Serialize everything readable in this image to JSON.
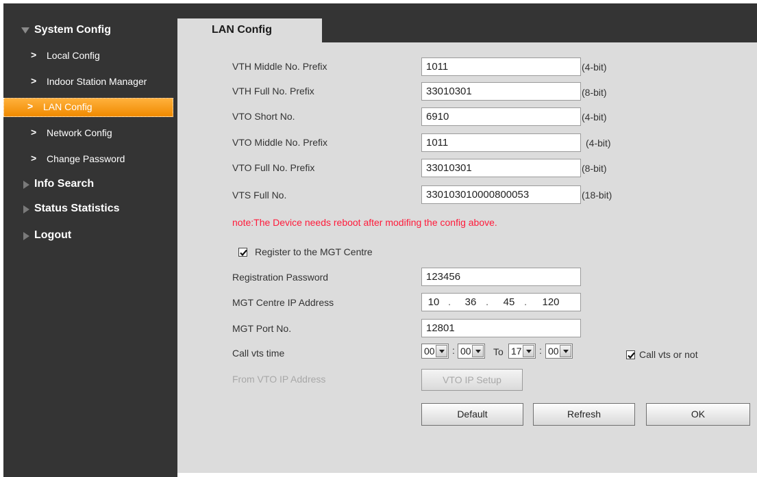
{
  "sidebar": {
    "sections": [
      {
        "label": "System Config",
        "expanded": true
      },
      {
        "label": "Info Search",
        "expanded": false
      },
      {
        "label": "Status Statistics",
        "expanded": false
      },
      {
        "label": "Logout",
        "expanded": false
      }
    ],
    "items": [
      {
        "label": "Local Config"
      },
      {
        "label": "Indoor Station Manager"
      },
      {
        "label": "LAN Config",
        "active": true
      },
      {
        "label": "Network Config"
      },
      {
        "label": "Change Password"
      }
    ]
  },
  "tab": {
    "label": "LAN Config"
  },
  "form": {
    "vth_middle_prefix": {
      "label": "VTH Middle No. Prefix",
      "value": "1011",
      "unit": "(4-bit)"
    },
    "vth_full_prefix": {
      "label": "VTH Full No. Prefix",
      "value": "33010301",
      "unit": "(8-bit)"
    },
    "vto_short_no": {
      "label": "VTO Short No.",
      "value": "6910",
      "unit": "(4-bit)"
    },
    "vto_middle_prefix": {
      "label": "VTO Middle No. Prefix",
      "value": "1011",
      "unit": "(4-bit)"
    },
    "vto_full_prefix": {
      "label": "VTO Full No. Prefix",
      "value": "33010301",
      "unit": "(8-bit)"
    },
    "vts_full_no": {
      "label": "VTS Full No.",
      "value": "330103010000800053",
      "unit": "(18-bit)"
    },
    "note": "note:The Device needs reboot after modifing the config above.",
    "register_mgt": {
      "label": "Register to the MGT Centre",
      "checked": true
    },
    "registration_password": {
      "label": "Registration Password",
      "value": "123456"
    },
    "mgt_ip": {
      "label": "MGT Centre IP Address",
      "octets": [
        "10",
        "36",
        "45",
        "120"
      ]
    },
    "mgt_port": {
      "label": "MGT Port No.",
      "value": "12801"
    },
    "call_vts_time": {
      "label": "Call vts time",
      "start_hour": "00",
      "start_minute": "00",
      "to_label": "To",
      "end_hour": "17",
      "end_minute": "00",
      "call_vts_label": "Call vts or not",
      "call_vts_checked": true
    },
    "vto_ip": {
      "label": "From VTO IP Address",
      "button_label": "VTO IP Setup"
    }
  },
  "buttons": {
    "default": "Default",
    "refresh": "Refresh",
    "ok": "OK"
  },
  "colors": {
    "sidebar_bg": "#343434",
    "content_bg": "#dcdcdc",
    "active_item": "#f59a16",
    "note_red": "#ff1a3a"
  }
}
